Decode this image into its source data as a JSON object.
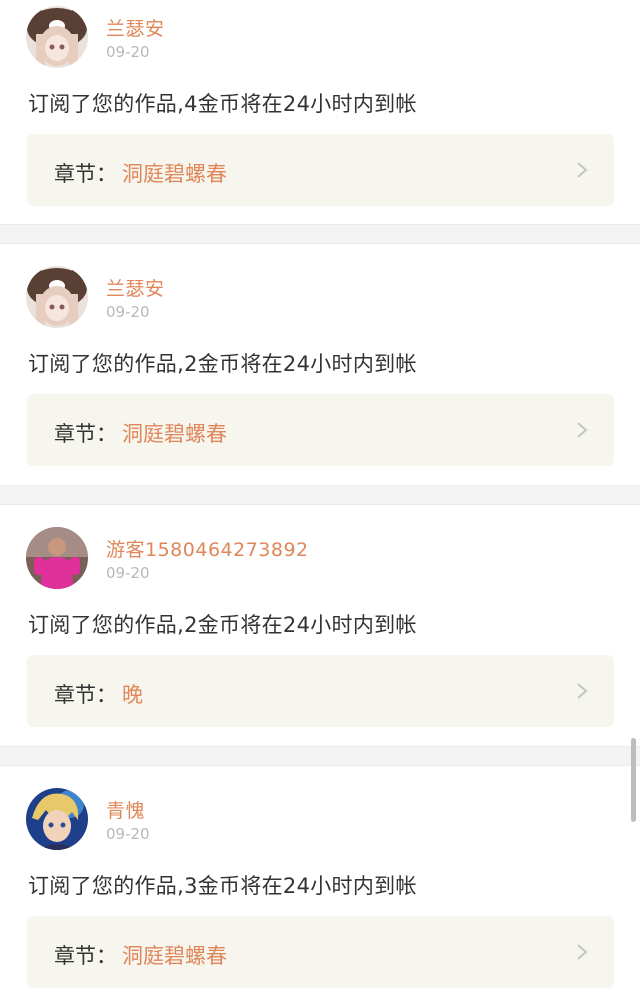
{
  "notifications": [
    {
      "username": "兰瑟安",
      "date": "09-20",
      "message": "订阅了您的作品,4金币将在24小时内到帐",
      "chapter_label": "章节：",
      "chapter_name": "洞庭碧螺春",
      "avatar": "anime-girl-bear-hat-avatar"
    },
    {
      "username": "兰瑟安",
      "date": "09-20",
      "message": "订阅了您的作品,2金币将在24小时内到帐",
      "chapter_label": "章节：",
      "chapter_name": "洞庭碧螺春",
      "avatar": "anime-girl-bear-hat-avatar"
    },
    {
      "username": "游客1580464273892",
      "date": "09-20",
      "message": "订阅了您的作品,2金币将在24小时内到帐",
      "chapter_label": "章节：",
      "chapter_name": "晚",
      "avatar": "photo-person-pink-avatar"
    },
    {
      "username": "青愧",
      "date": "09-20",
      "message": "订阅了您的作品,3金币将在24小时内到帐",
      "chapter_label": "章节：",
      "chapter_name": "洞庭碧螺春",
      "avatar": "anime-boy-blue-avatar"
    }
  ],
  "colors": {
    "accent": "#e0875a",
    "text": "#333333",
    "muted": "#b8b8b8",
    "chapter_bg": "#f6f6ef",
    "separator": "#f3f3f3"
  }
}
